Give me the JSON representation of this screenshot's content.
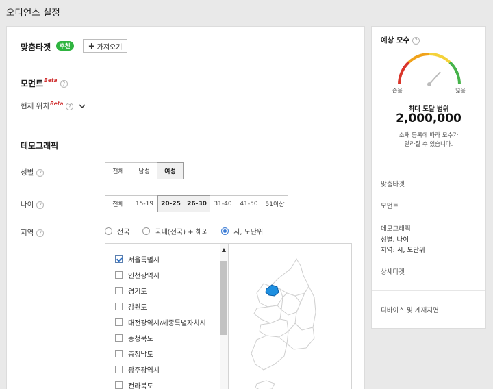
{
  "page": {
    "title": "오디언스 설정"
  },
  "custom_target": {
    "title": "맞춤타겟",
    "badge": "추천",
    "import_label": "가져오기"
  },
  "moment": {
    "title": "모먼트",
    "beta": "Beta",
    "current_location_label": "현재 위치",
    "current_location_beta": "Beta"
  },
  "demographic": {
    "title": "데모그래픽",
    "gender": {
      "label": "성별",
      "options": [
        "전체",
        "남성",
        "여성"
      ],
      "selected": "여성"
    },
    "age": {
      "label": "나이",
      "options": [
        "전체",
        "15-19",
        "20-25",
        "26-30",
        "31-40",
        "41-50",
        "51이상"
      ],
      "selected": [
        "20-25",
        "26-30"
      ]
    },
    "region": {
      "label": "지역",
      "radios": [
        "전국",
        "국내(전국) + 해외",
        "시, 도단위"
      ],
      "selected_radio": "시, 도단위",
      "items": [
        {
          "label": "서울특별시",
          "checked": true
        },
        {
          "label": "인천광역시",
          "checked": false
        },
        {
          "label": "경기도",
          "checked": false
        },
        {
          "label": "강원도",
          "checked": false
        },
        {
          "label": "대전광역시/세종특별자치시",
          "checked": false
        },
        {
          "label": "충청북도",
          "checked": false
        },
        {
          "label": "충청남도",
          "checked": false
        },
        {
          "label": "광주광역시",
          "checked": false
        },
        {
          "label": "전라북도",
          "checked": false
        }
      ]
    }
  },
  "sidebar": {
    "title": "예상 모수",
    "gauge_low": "좁음",
    "gauge_high": "넓음",
    "max_reach_label": "최대 도달 범위",
    "max_reach_value": "2,000,000",
    "note_line1": "소재 등록에 따라 모수가",
    "note_line2": "달라질 수 있습니다.",
    "summary": {
      "custom_target": "맞춤타겟",
      "moment": "모먼트",
      "demographic": "데모그래픽",
      "demographic_line1": "성별, 나이",
      "demographic_line2": "지역: 시, 도단위",
      "detail_target": "상세타겟",
      "device": "디바이스 및 게재지면"
    }
  },
  "colors": {
    "accent_green": "#2fb440",
    "beta_red": "#d03030",
    "selected_region": "#1e8fe0"
  }
}
